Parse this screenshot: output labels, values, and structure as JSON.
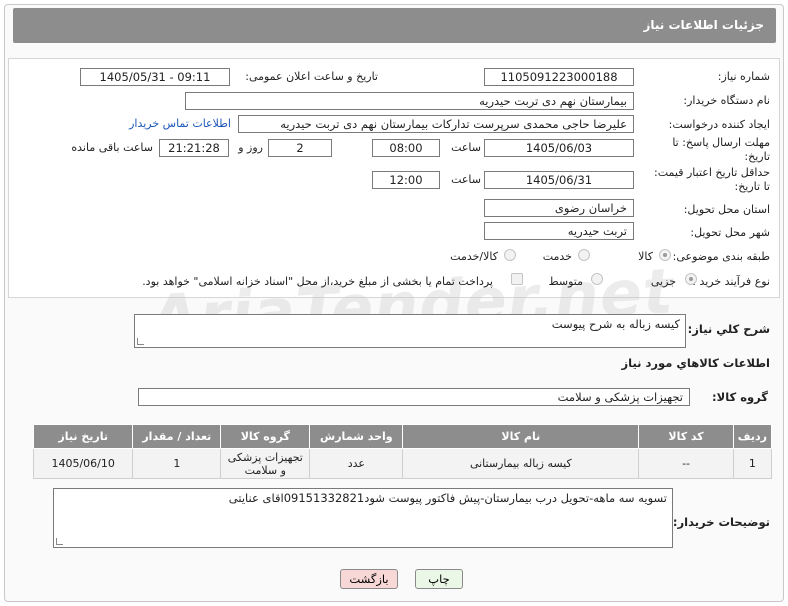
{
  "header": {
    "title": "جزئیات اطلاعات نیاز"
  },
  "fields": {
    "need_number_label": "شماره نیاز:",
    "need_number": "1105091223000188",
    "announce_label": "تاریخ و ساعت اعلان عمومی:",
    "announce_value": "1405/05/31 - 09:11",
    "buyer_org_label": "نام دستگاه خریدار:",
    "buyer_org": "بیمارستان نهم دی تربت حیدریه",
    "creator_label": "ایجاد کننده درخواست:",
    "creator": "علیرضا حاجی محمدی سرپرست تدارکات بیمارستان نهم دی تربت حیدریه",
    "contact_link": "اطلاعات تماس خریدار",
    "deadline_label_1": "مهلت ارسال پاسخ: تا",
    "deadline_label_2": "تاریخ:",
    "deadline_date": "1405/06/03",
    "time_label": "ساعت",
    "deadline_time": "08:00",
    "days_value": "2",
    "days_label": "روز و",
    "remaining_time": "21:21:28",
    "remaining_label": "ساعت باقی مانده",
    "min_price_label_1": "حداقل تاریخ اعتبار قیمت:",
    "min_price_label_2": "تا تاریخ:",
    "price_date": "1405/06/31",
    "price_time": "12:00",
    "province_label": "استان محل تحویل:",
    "province": "خراسان رضوی",
    "city_label": "شهر محل تحویل:",
    "city": "تربت حیدریه",
    "category_label": "طبقه بندی موضوعی:",
    "category_options": [
      "کالا",
      "خدمت",
      "کالا/خدمت"
    ],
    "process_label": "نوع فرآیند خرید :",
    "process_options": [
      "جزیی",
      "متوسط"
    ],
    "payment_note": "پرداخت تمام یا بخشی از مبلغ خرید،از محل \"اسناد خزانه اسلامی\" خواهد بود."
  },
  "summary": {
    "label": "شرح کلي نياز:",
    "value": "کیسه زباله به شرح پیوست"
  },
  "goods_section": {
    "title": "اطلاعات کالاهاي مورد نياز",
    "group_label": "گروه کالا:",
    "group_value": "تجهیزات پزشکی و سلامت"
  },
  "table": {
    "headers": [
      "ردیف",
      "کد کالا",
      "نام کالا",
      "واحد شمارش",
      "گروه کالا",
      "تعداد / مقدار",
      "تاریخ نیاز"
    ],
    "rows": [
      [
        "1",
        "--",
        "کیسه زباله بیمارستانی",
        "عدد",
        "تجهیزات پزشکی و سلامت",
        "1",
        "1405/06/10"
      ]
    ]
  },
  "buyer_notes": {
    "label": "توضیحات خریدار:",
    "value": "تسویه سه ماهه-تحویل درب بیمارستان-پیش فاکتور پیوست شود09151332821اقای عنایتی"
  },
  "buttons": {
    "print": "چاپ",
    "back": "بازگشت"
  },
  "watermark": "AriaTender.net",
  "colors": {
    "header": "#8d8d8d",
    "link": "#1c57b8",
    "back_button": "#f8d7d7",
    "print_button": "#eaf7e6"
  }
}
